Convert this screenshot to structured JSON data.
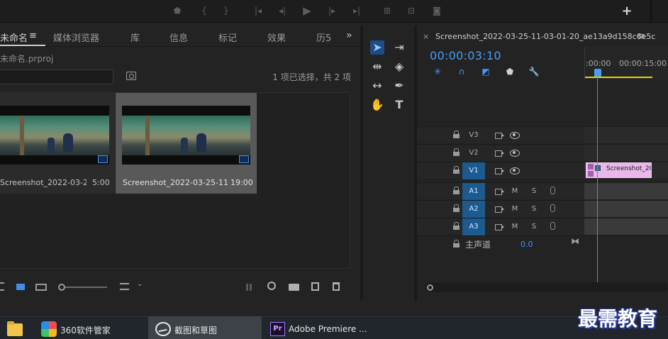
{
  "project_panel": {
    "tabs": [
      {
        "label": "未命名",
        "active": true
      },
      {
        "label": "媒体浏览器"
      },
      {
        "label": "库"
      },
      {
        "label": "信息"
      },
      {
        "label": "标记"
      },
      {
        "label": "效果"
      },
      {
        "label": "历5"
      }
    ],
    "tab_menu_glyph": "≡",
    "more_tabs_glyph": "»",
    "project_file": "未命名.prproj",
    "search_value": "",
    "selection_status": "1 项已选择，共 2 项",
    "clips": [
      {
        "name": "Screenshot_2022-03-25-11-0...",
        "duration": "5:00",
        "selected": false
      },
      {
        "name": "Screenshot_2022-03-25-11-...",
        "duration": "19:00",
        "selected": true
      }
    ]
  },
  "timeline": {
    "sequence_name": "Screenshot_2022-03-25-11-03-01-20_ae13a9d158c6e5c",
    "close_glyph": "×",
    "menu_glyph": "≡",
    "timecode": "00:00:03:10",
    "ruler_labels": [
      ":00:00",
      "00:00:15:00"
    ],
    "video_tracks": [
      "V3",
      "V2",
      "V1"
    ],
    "audio_tracks": [
      "A1",
      "A2",
      "A3"
    ],
    "mute_label": "M",
    "solo_label": "S",
    "master_label": "主声道",
    "master_volume": "0.0",
    "clip_on_v1": "Screenshot_20"
  },
  "taskbar": {
    "items": [
      {
        "label": ""
      },
      {
        "label": "360软件管家"
      },
      {
        "label": "截图和草图"
      },
      {
        "label": "Adobe Premiere ..."
      }
    ],
    "premiere_icon_text": "Pr"
  },
  "watermark": "最需教育",
  "colors": {
    "accent_blue": "#4a9df5",
    "track_on": "#1c5a8f",
    "clip_pink": "#e9b7e9",
    "work_area": "#e8d400"
  }
}
